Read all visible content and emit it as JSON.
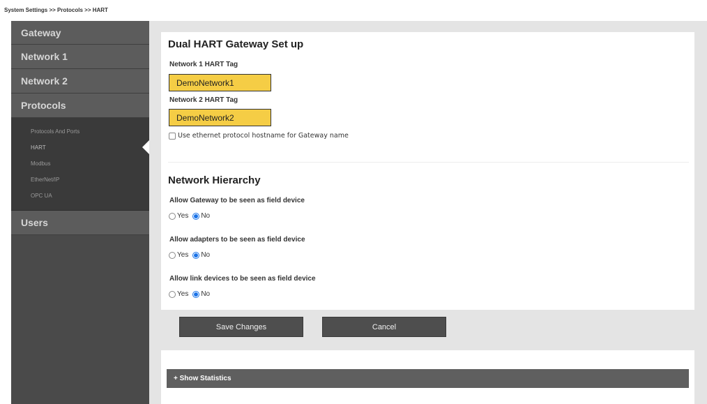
{
  "breadcrumb": "System Settings >> Protocols >> HART",
  "sidebar": {
    "items": [
      {
        "label": "Gateway"
      },
      {
        "label": "Network 1"
      },
      {
        "label": "Network 2"
      },
      {
        "label": "Protocols"
      },
      {
        "label": "Users"
      }
    ],
    "protocols_sub": [
      {
        "label": "Protocols And Ports"
      },
      {
        "label": "HART"
      },
      {
        "label": "Modbus"
      },
      {
        "label": "EtherNet/IP"
      },
      {
        "label": "OPC UA"
      }
    ],
    "active_sub": "HART"
  },
  "setup": {
    "title": "Dual HART Gateway Set up",
    "network1_label": "Network 1 HART Tag",
    "network1_value": "DemoNetwork1",
    "network2_label": "Network 2 HART Tag",
    "network2_value": "DemoNetwork2",
    "hostname_checkbox_label": "Use ethernet protocol hostname for Gateway name",
    "hostname_checked": false
  },
  "hierarchy": {
    "title": "Network Hierarchy",
    "yes_label": "Yes",
    "no_label": "No",
    "questions": [
      {
        "label": "Allow Gateway to be seen as field device",
        "selected": "No"
      },
      {
        "label": "Allow adapters to be seen as field device",
        "selected": "No"
      },
      {
        "label": "Allow link devices to be seen as field device",
        "selected": "No"
      }
    ]
  },
  "buttons": {
    "save_label": "Save Changes",
    "cancel_label": "Cancel"
  },
  "statistics": {
    "label": "+ Show Statistics"
  },
  "colors": {
    "tag_input_bg": "#f5cd45",
    "radio_selected": "#1a73e8"
  }
}
